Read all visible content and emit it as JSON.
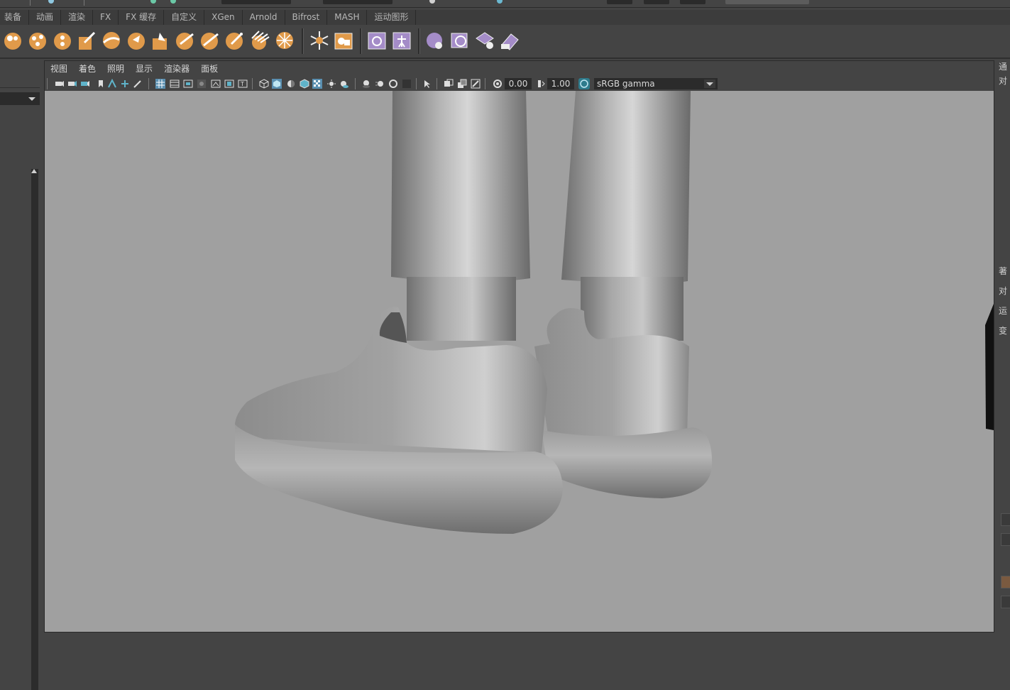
{
  "shelf_tabs": [
    "装备",
    "动画",
    "渲染",
    "FX",
    "FX 缓存",
    "自定义",
    "XGen",
    "Arnold",
    "Bifrost",
    "MASH",
    "运动图形"
  ],
  "shelf_icons": [
    "fluid-container-icon",
    "fluid-emitter-icon",
    "fluid-bubble-icon",
    "paint-brush-icon",
    "ocean-surface-icon",
    "particle-emitter-icon",
    "particle-fill-icon",
    "nhair-icon",
    "nhair-paint-icon",
    "nhair-edit-icon",
    "fur-brush-icon",
    "field-icon",
    "snowflake-icon",
    "shatter-icon",
    "cache-create-icon",
    "skeleton-icon",
    "cloth-icon",
    "collider-icon",
    "dynamic-constraint-icon",
    "eraser-icon"
  ],
  "panel_menu": [
    "视图",
    "着色",
    "照明",
    "显示",
    "渲染器",
    "面板"
  ],
  "toolbar": {
    "exposure": "0.00",
    "gamma": "1.00",
    "color_management": "sRGB gamma"
  },
  "right_panel_glyphs": [
    "通",
    "对",
    "著",
    "对",
    "运",
    "变"
  ],
  "colors": {
    "ui_bg": "#444444",
    "viewport_bg": "#a0a0a0",
    "shelf_orange": "#e09a4a",
    "shelf_purple": "#a48cc8",
    "toolbar_accent": "#5fb3c9"
  }
}
